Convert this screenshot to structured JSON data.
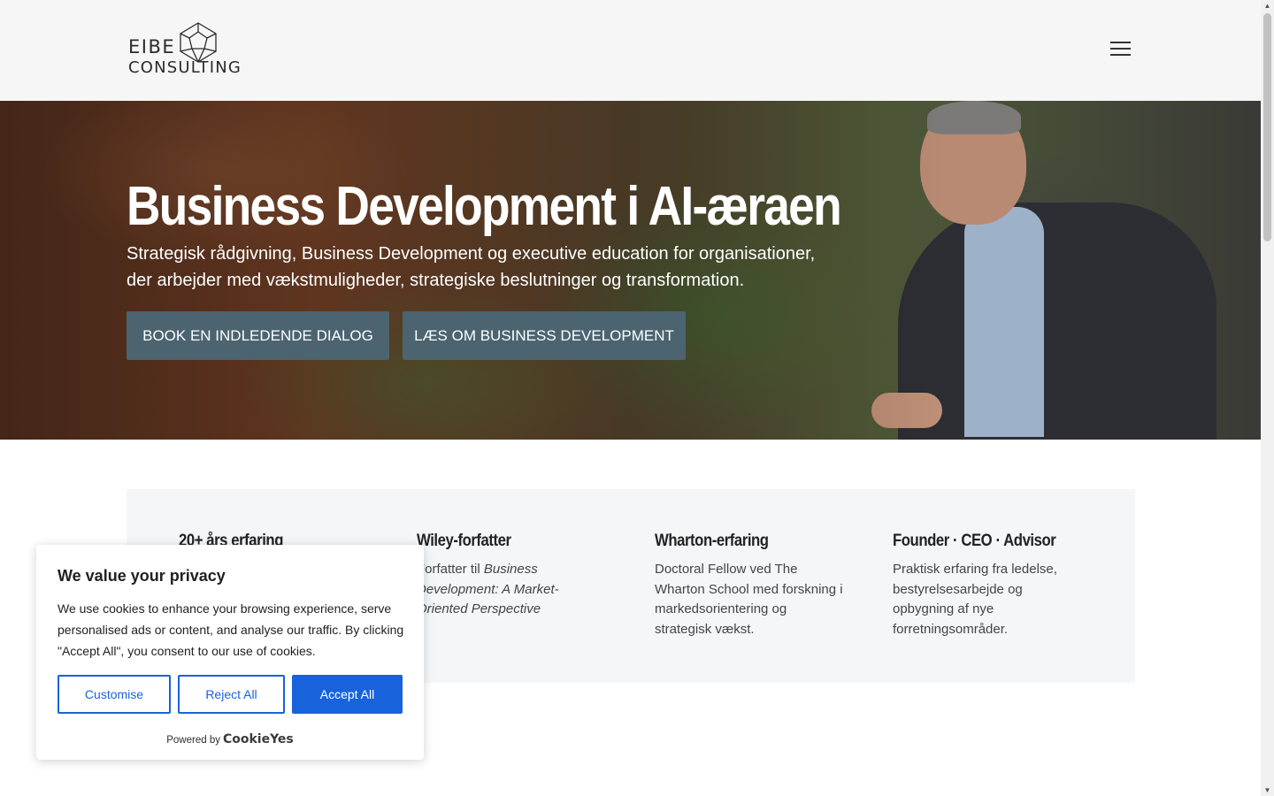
{
  "header": {
    "logo_line1": "EIBE",
    "logo_line2": "CONSULTING",
    "menu_icon": "hamburger-icon"
  },
  "hero": {
    "title": "Business Development i AI-æraen",
    "subtitle": "Strategisk rådgivning, Business Development og executive education for organisationer, der arbejder med vækstmuligheder, strategiske beslutninger og transformation.",
    "buttons": {
      "book": "BOOK EN INDLEDENDE DIALOG",
      "laes": "LÆS OM BUSINESS DEVELOPMENT"
    }
  },
  "features": [
    {
      "title": "20+ års erfaring",
      "text": ""
    },
    {
      "title": "Wiley-forfatter",
      "text_prefix": "Forfatter til ",
      "text_italic": "Business Development: A Market-Oriented Perspective"
    },
    {
      "title": "Wharton-erfaring",
      "text": "Doctoral Fellow ved The Wharton School med forskning i markedsorientering og strategisk vækst."
    },
    {
      "title": "Founder · CEO · Advisor",
      "text": "Praktisk erfaring fra ledelse, bestyrelsesarbejde og opbygning af nye forretningsområder."
    }
  ],
  "cookie": {
    "title": "We value your privacy",
    "text": "We use cookies to enhance your browsing experience, serve personalised ads or content, and analyse our traffic. By clicking \"Accept All\", you consent to our use of cookies.",
    "customise": "Customise",
    "reject": "Reject All",
    "accept": "Accept All",
    "powered_by": "Powered by",
    "brand": "CookieYes"
  },
  "colors": {
    "hero_button": "#4b6470",
    "cookie_accent": "#1863dc",
    "features_bg": "#f4f7f8"
  }
}
